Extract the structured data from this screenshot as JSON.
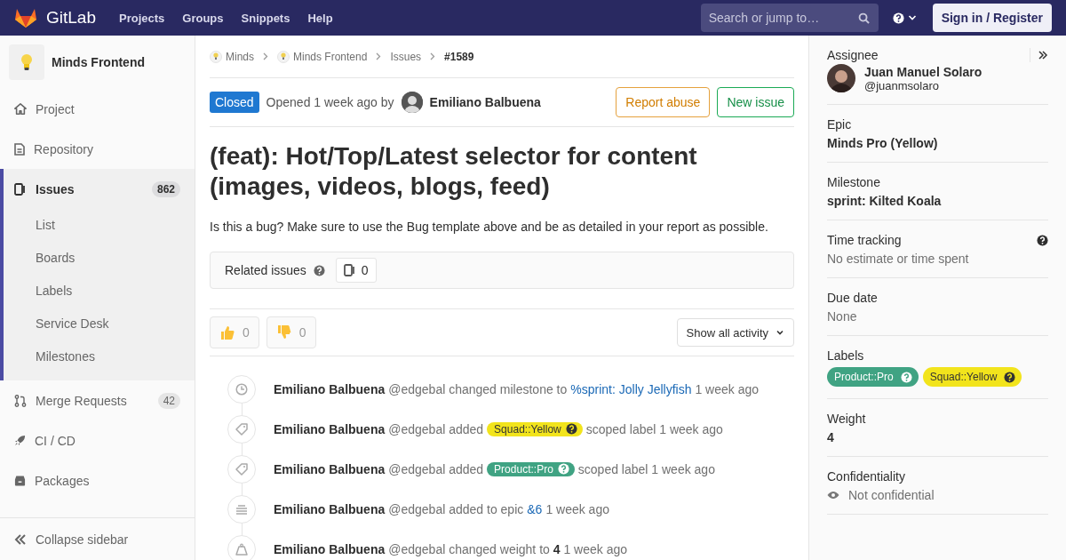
{
  "navbar": {
    "brand": "GitLab",
    "menu": [
      "Projects",
      "Groups",
      "Snippets",
      "Help"
    ],
    "search": {
      "placeholder": "Search or jump to…"
    },
    "sign_in": "Sign in / Register"
  },
  "sidebar": {
    "project": "Minds Frontend",
    "items": [
      {
        "label": "Project",
        "selected": false
      },
      {
        "label": "Repository",
        "selected": false
      },
      {
        "label": "Issues",
        "count": "862",
        "selected": true,
        "children": [
          {
            "label": "List",
            "selected": false
          },
          {
            "label": "Boards",
            "selected": false
          },
          {
            "label": "Labels",
            "selected": false
          },
          {
            "label": "Service Desk",
            "selected": false
          },
          {
            "label": "Milestones",
            "selected": false
          }
        ]
      },
      {
        "label": "Merge Requests",
        "count": "42",
        "selected": false
      },
      {
        "label": "CI / CD",
        "selected": false
      },
      {
        "label": "Packages",
        "selected": false
      }
    ],
    "collapse": "Collapse sidebar"
  },
  "breadcrumb": [
    {
      "label": "Minds",
      "avatar": true,
      "current": false
    },
    {
      "label": "Minds Frontend",
      "avatar": true,
      "current": false
    },
    {
      "label": "Issues",
      "avatar": false,
      "current": false
    },
    {
      "label": "#1589",
      "avatar": false,
      "current": true
    }
  ],
  "issue": {
    "status": "Closed",
    "opened": "Opened 1 week ago by",
    "author": "Emiliano Balbuena",
    "buttons": [
      {
        "label": "Report abuse",
        "kind": "warning"
      },
      {
        "label": "New issue",
        "kind": "success"
      }
    ],
    "title": "(feat): Hot/Top/Latest selector for content (images, videos, blogs, feed)",
    "description": "Is this a bug? Make sure to use the Bug template above and be as detailed in your report as possible.",
    "related": {
      "label": "Related issues",
      "count": "0"
    },
    "awards": [
      {
        "kind": "thumbsup",
        "count": "0"
      },
      {
        "kind": "thumbsdown",
        "count": "0"
      }
    ],
    "activity_filter": "Show all activity",
    "events": [
      {
        "kind": "milestone",
        "author": "Emiliano Balbuena",
        "parts": [
          {
            "kind": "text",
            "text": "@edgebal changed milestone to"
          },
          {
            "kind": "link",
            "text": "%sprint: Jolly Jellyfish"
          },
          {
            "kind": "text",
            "text": "1 week ago"
          }
        ]
      },
      {
        "kind": "label",
        "author": "Emiliano Balbuena",
        "parts": [
          {
            "kind": "text",
            "text": "@edgebal added"
          },
          {
            "kind": "label",
            "text": "Squad::Yellow",
            "color": "#f2e41c"
          },
          {
            "kind": "text",
            "text": "scoped label 1 week ago"
          }
        ]
      },
      {
        "kind": "label",
        "author": "Emiliano Balbuena",
        "parts": [
          {
            "kind": "text",
            "text": "@edgebal added"
          },
          {
            "kind": "label",
            "text": "Product::Pro",
            "color": "#40a383"
          },
          {
            "kind": "text",
            "text": "scoped label 1 week ago"
          }
        ]
      },
      {
        "kind": "epic",
        "author": "Emiliano Balbuena",
        "parts": [
          {
            "kind": "text",
            "text": "@edgebal added to epic"
          },
          {
            "kind": "link",
            "text": "&6"
          },
          {
            "kind": "text",
            "text": "1 week ago"
          }
        ]
      },
      {
        "kind": "weight",
        "author": "Emiliano Balbuena",
        "parts": [
          {
            "kind": "text",
            "text": "@edgebal changed weight to **4** 1 week ago"
          }
        ]
      }
    ]
  },
  "details": [
    {
      "kind": "assignee",
      "title": "Assignee",
      "name": "Juan Manuel Solaro",
      "handle": "@juanmsolaro"
    },
    {
      "kind": "value",
      "title": "Epic",
      "value": "Minds Pro (Yellow)"
    },
    {
      "kind": "value",
      "title": "Milestone",
      "value": "sprint: Kilted Koala"
    },
    {
      "kind": "muted",
      "title": "Time tracking",
      "value": "No estimate or time spent",
      "help": true
    },
    {
      "kind": "muted",
      "title": "Due date",
      "value": "None"
    },
    {
      "kind": "labels",
      "title": "Labels",
      "labels": [
        {
          "text": "Product::Pro",
          "color": "#40a383"
        },
        {
          "text": "Squad::Yellow",
          "color": "#f2e41c"
        }
      ]
    },
    {
      "kind": "value",
      "title": "Weight",
      "value": "4"
    },
    {
      "kind": "confidential",
      "title": "Confidentiality",
      "value": "Not confidential"
    }
  ]
}
